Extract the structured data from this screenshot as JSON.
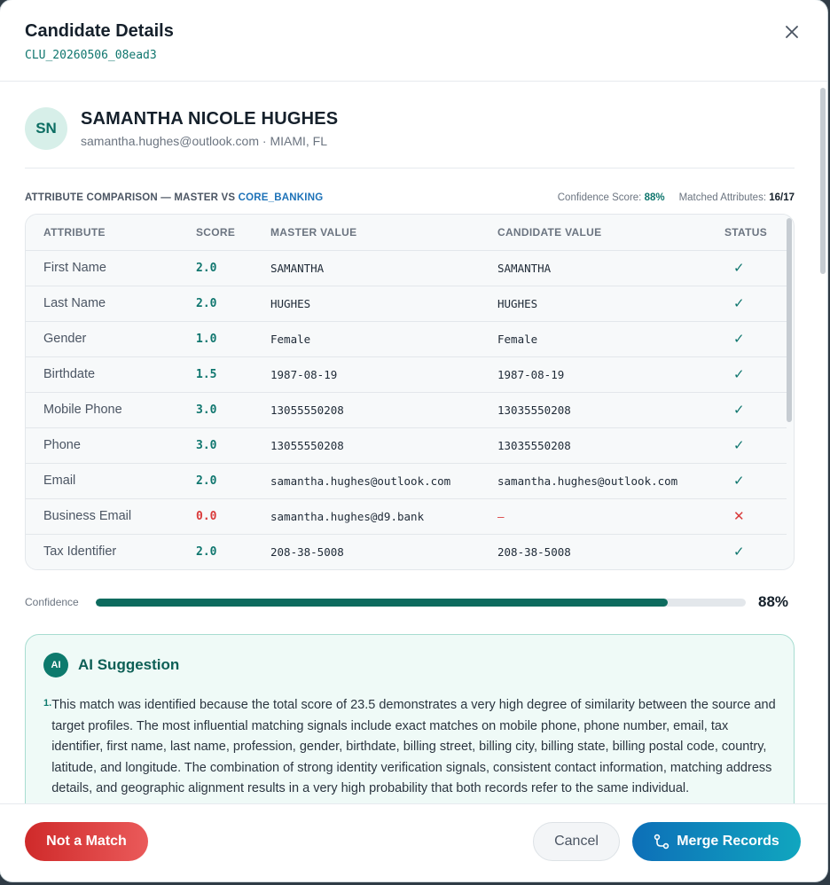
{
  "modal": {
    "title": "Candidate Details",
    "cluster_id": "CLU_20260506_08ead3"
  },
  "profile": {
    "initials": "SN",
    "name": "SAMANTHA NICOLE HUGHES",
    "meta": "samantha.hughes@outlook.com · MIAMI, FL"
  },
  "comparison": {
    "title_prefix": "ATTRIBUTE COMPARISON — MASTER VS ",
    "source": "CORE_BANKING",
    "confidence_label": "Confidence Score: ",
    "confidence_value": "88%",
    "matched_label": "Matched Attributes: ",
    "matched_value": "16/17"
  },
  "table": {
    "headers": [
      "ATTRIBUTE",
      "SCORE",
      "MASTER VALUE",
      "CANDIDATE VALUE",
      "STATUS"
    ],
    "rows": [
      {
        "attribute": "First Name",
        "score": "2.0",
        "master": "SAMANTHA",
        "candidate": "SAMANTHA",
        "status": "match"
      },
      {
        "attribute": "Last Name",
        "score": "2.0",
        "master": "HUGHES",
        "candidate": "HUGHES",
        "status": "match"
      },
      {
        "attribute": "Gender",
        "score": "1.0",
        "master": "Female",
        "candidate": "Female",
        "status": "match"
      },
      {
        "attribute": "Birthdate",
        "score": "1.5",
        "master": "1987-08-19",
        "candidate": "1987-08-19",
        "status": "match"
      },
      {
        "attribute": "Mobile Phone",
        "score": "3.0",
        "master": "13055550208",
        "candidate": "13035550208",
        "status": "match"
      },
      {
        "attribute": "Phone",
        "score": "3.0",
        "master": "13055550208",
        "candidate": "13035550208",
        "status": "match"
      },
      {
        "attribute": "Email",
        "score": "2.0",
        "master": "samantha.hughes@outlook.com",
        "candidate": "samantha.hughes@outlook.com",
        "status": "match"
      },
      {
        "attribute": "Business Email",
        "score": "0.0",
        "master": "samantha.hughes@d9.bank",
        "candidate": "–",
        "status": "mismatch"
      },
      {
        "attribute": "Tax Identifier",
        "score": "2.0",
        "master": "208-38-5008",
        "candidate": "208-38-5008",
        "status": "match"
      }
    ]
  },
  "confidence": {
    "label": "Confidence",
    "percent": 88,
    "display": "88%"
  },
  "ai": {
    "badge": "AI",
    "title": "AI Suggestion",
    "items": [
      {
        "num": "1.",
        "text": "This match was identified because the total score of 23.5 demonstrates a very high degree of similarity between the source and target profiles. The most influential matching signals include exact matches on mobile phone, phone number, email, tax identifier, first name, last name, profession, gender, birthdate, billing street, billing city, billing state, billing postal code, country, latitude, and longitude. The combination of strong identity verification signals, consistent contact information, matching address details, and geographic alignment results in a very high probability that both records refer to the same individual."
      }
    ]
  },
  "footer": {
    "reject_label": "Not a Match",
    "cancel_label": "Cancel",
    "merge_label": "Merge Records"
  },
  "colors": {
    "accent_green": "#0f766e",
    "danger_red": "#d93a3a",
    "merge_blue": "#0d6fb8"
  }
}
